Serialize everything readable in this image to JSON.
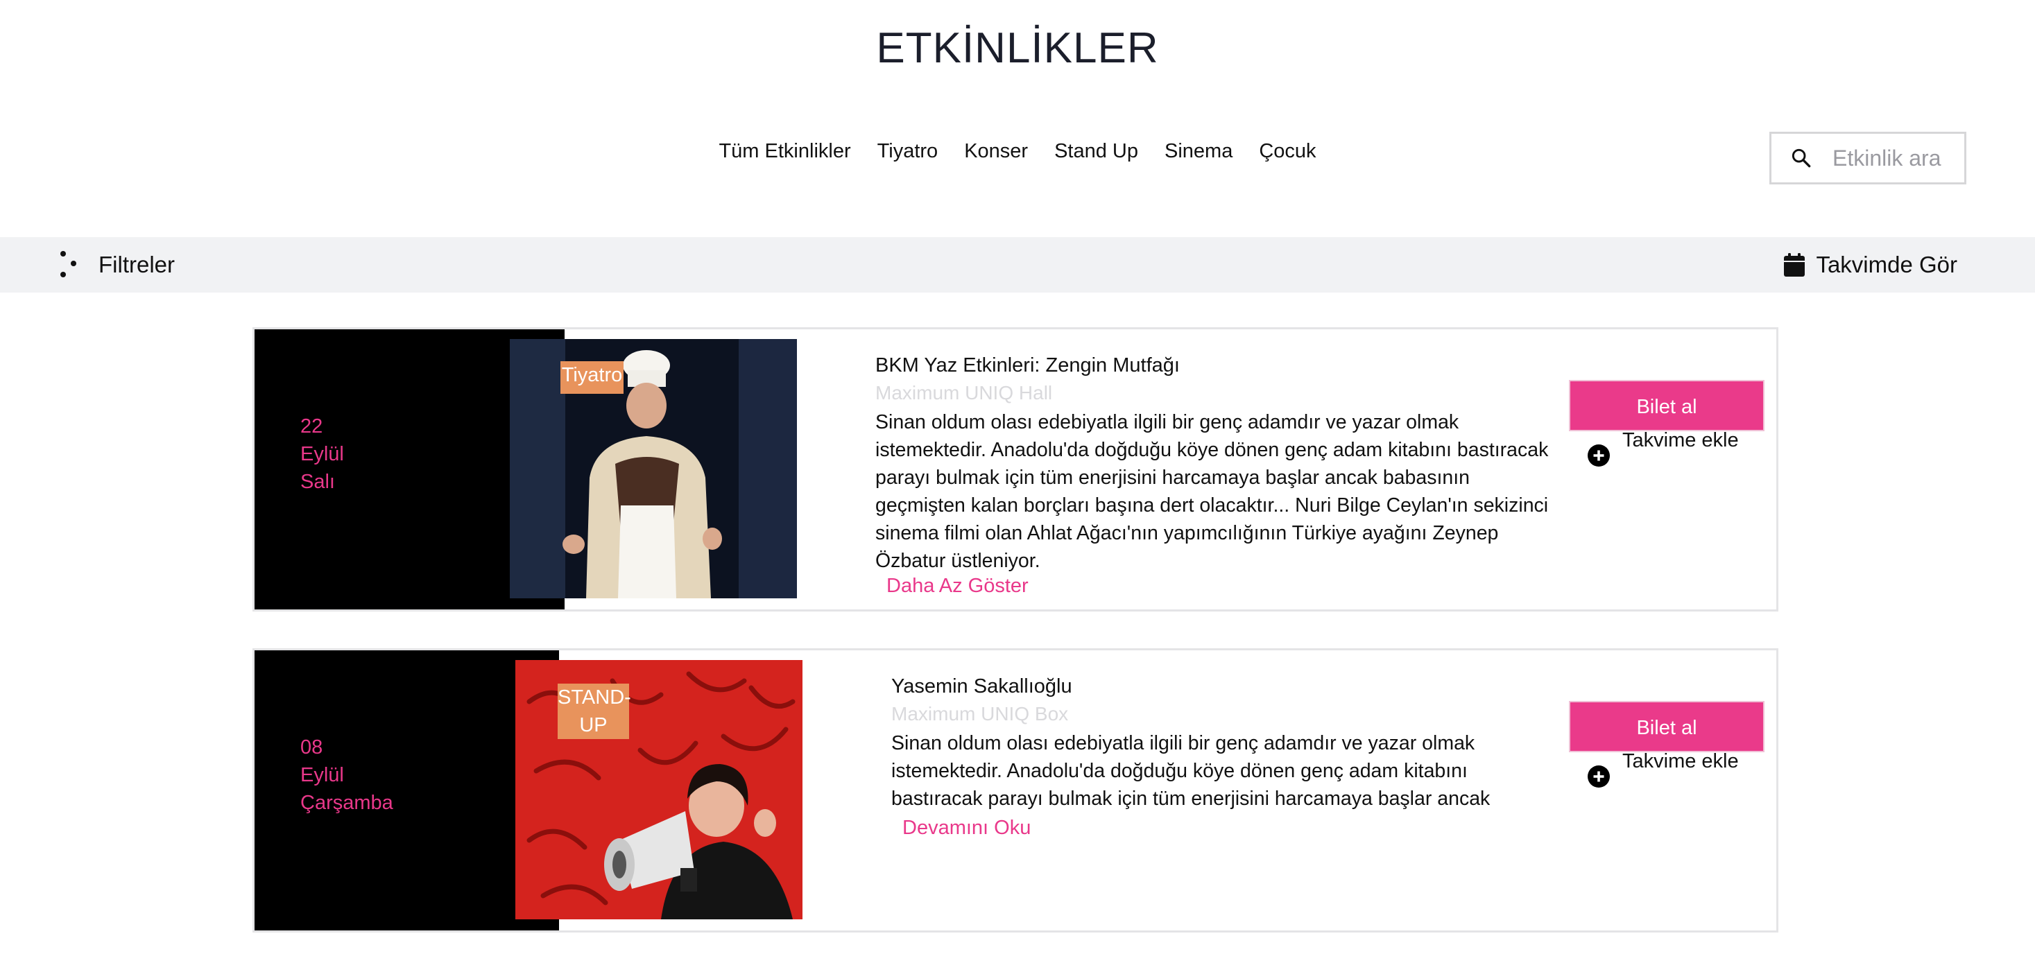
{
  "page": {
    "title": "ETKİNLİKLER"
  },
  "nav": {
    "items": [
      "Tüm Etkinlikler",
      "Tiyatro",
      "Konser",
      "Stand Up",
      "Sinema",
      "Çocuk"
    ]
  },
  "search": {
    "placeholder": "Etkinlik ara",
    "value": ""
  },
  "filter_bar": {
    "filters_label": "Filtreler",
    "calendar_label": "Takvimde Gör"
  },
  "events": [
    {
      "day": "22",
      "month": "Eylül",
      "weekday": "Salı",
      "category": "Tiyatro",
      "title": "BKM Yaz Etkinleri: Zengin Mutfağı",
      "venue": "Maximum UNIQ Hall",
      "description": "Sinan oldum olası edebiyatla ilgili bir genç adamdır ve yazar olmak istemektedir. Anadolu'da doğduğu köye dönen genç adam kitabını bastıracak parayı bulmak için tüm enerjisini harcamaya başlar ancak babasının geçmişten kalan borçları başına dert olacaktır... Nuri Bilge Ceylan'ın sekizinci sinema filmi olan Ahlat Ağacı'nın yapımcılığının Türkiye ayağını Zeynep Özbatur üstleniyor.",
      "toggle_label": "Daha Az Göster",
      "buy_label": "Bilet al",
      "add_calendar_label": "Takvime ekle"
    },
    {
      "day": "08",
      "month": "Eylül",
      "weekday": "Çarşamba",
      "category": "STAND-UP",
      "title": "Yasemin Sakallıoğlu",
      "venue": "Maximum UNIQ Box",
      "description": "Sinan oldum olası edebiyatla ilgili bir genç adamdır ve yazar olmak istemektedir. Anadolu'da doğduğu köye dönen genç adam kitabını bastıracak parayı bulmak için tüm enerjisini harcamaya başlar ancak",
      "toggle_label": "Devamını Oku",
      "buy_label": "Bilet al",
      "add_calendar_label": "Takvime ekle"
    }
  ],
  "colors": {
    "accent": "#ea3a8a",
    "badge": "#e8935c",
    "filter_bar_bg": "#f1f2f4",
    "venue_text": "#d9d9dc"
  },
  "icons": [
    "search-icon",
    "filters-icon",
    "calendar-icon",
    "plus-circle-icon"
  ]
}
